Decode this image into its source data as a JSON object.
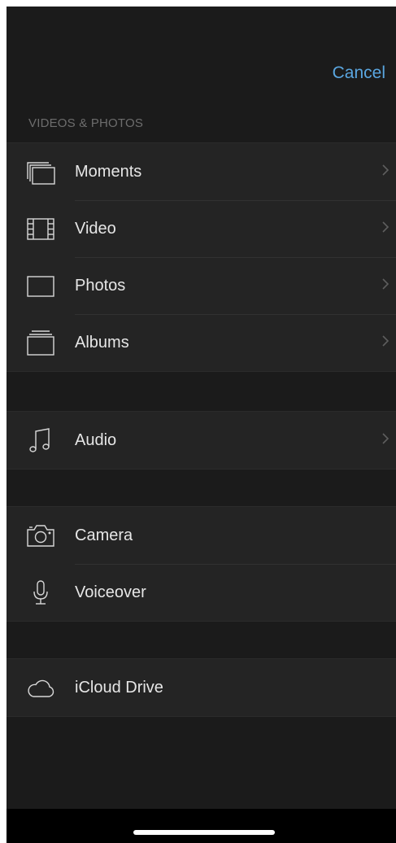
{
  "nav": {
    "cancel_label": "Cancel"
  },
  "section_header": "VIDEOS & PHOTOS",
  "media": {
    "moments": "Moments",
    "video": "Video",
    "photos": "Photos",
    "albums": "Albums"
  },
  "audio": {
    "label": "Audio"
  },
  "capture": {
    "camera": "Camera",
    "voiceover": "Voiceover"
  },
  "cloud": {
    "icloud": "iCloud Drive"
  },
  "icons": {
    "moments": "stacked-frames-icon",
    "video": "film-strip-icon",
    "photos": "photo-frame-icon",
    "albums": "album-stack-icon",
    "audio": "music-note-icon",
    "camera": "camera-icon",
    "voiceover": "microphone-icon",
    "icloud": "cloud-icon",
    "disclosure": "chevron-right-icon"
  },
  "colors": {
    "accent": "#5aa6e0",
    "background": "#1b1b1b",
    "row_background": "#242424",
    "text": "#e6e6e6",
    "section_text": "#6d6d6d"
  }
}
